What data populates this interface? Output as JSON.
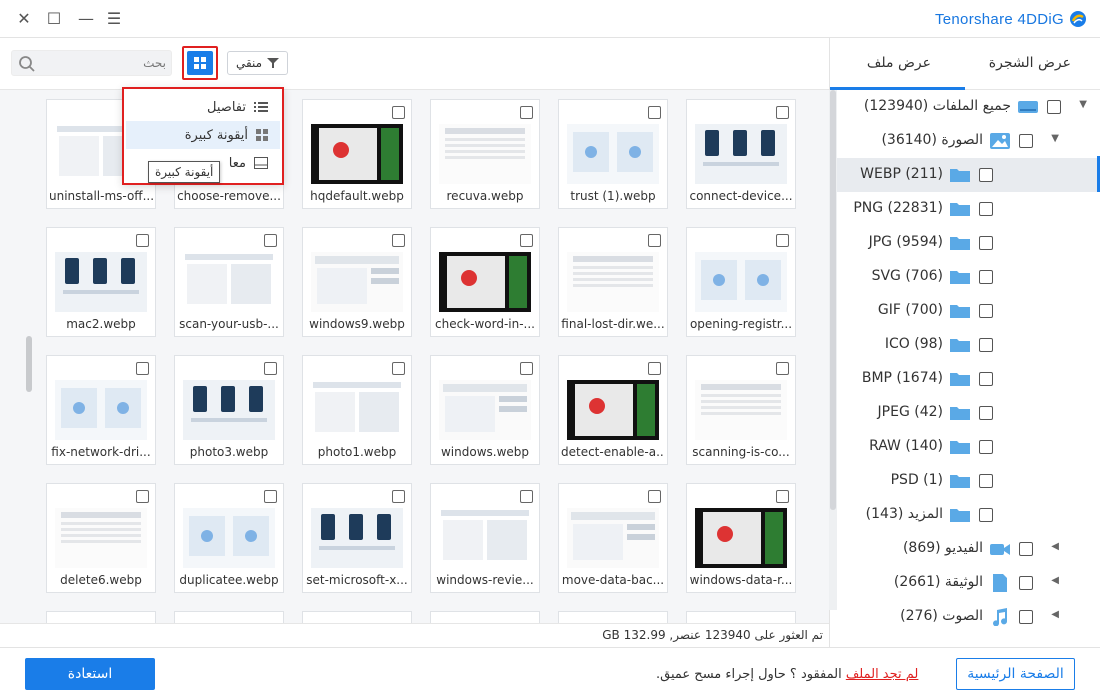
{
  "window": {
    "brand": "Tenorshare 4DDiG",
    "close_glyph": "✕",
    "maximize_glyph": "☐",
    "minimize_glyph": "—",
    "menu_glyph": "☰"
  },
  "toolbar": {
    "search_placeholder": "بحث",
    "filter_label": "منقي",
    "view_button_icon": "grid-icon"
  },
  "view_menu": {
    "items": [
      {
        "label": "تفاصيل",
        "icon": "list-icon"
      },
      {
        "label": "أيقونة كبيرة",
        "icon": "large-icon-grid-icon",
        "selected": true
      },
      {
        "label": "معا",
        "icon": "preview-icon"
      }
    ],
    "tooltip": "أيقونة كبيرة"
  },
  "files": [
    {
      "name": "connect-device..."
    },
    {
      "name": "trust (1).webp"
    },
    {
      "name": "recuva.webp"
    },
    {
      "name": "hqdefault.webp"
    },
    {
      "name": "choose-remove..."
    },
    {
      "name": "uninstall-ms-off..."
    },
    {
      "name": "opening-registr..."
    },
    {
      "name": "final-lost-dir.we..."
    },
    {
      "name": "check-word-in-..."
    },
    {
      "name": "windows9.webp"
    },
    {
      "name": "scan-your-usb-..."
    },
    {
      "name": "mac2.webp"
    },
    {
      "name": "scanning-is-co..."
    },
    {
      "name": "detect-enable-a..."
    },
    {
      "name": "windows.webp"
    },
    {
      "name": "photo1.webp"
    },
    {
      "name": "photo3.webp"
    },
    {
      "name": "fix-network-dri..."
    },
    {
      "name": "windows-data-r..."
    },
    {
      "name": "move-data-bac..."
    },
    {
      "name": "windows-revie..."
    },
    {
      "name": "set-microsoft-x..."
    },
    {
      "name": "duplicatee.webp"
    },
    {
      "name": "delete6.webp"
    }
  ],
  "status": {
    "text": "تم العثور على 123940 عنصر, 132.99 GB"
  },
  "panel": {
    "tabs": [
      {
        "label": "عرض الشجرة",
        "active": true
      },
      {
        "label": "عرض ملف",
        "active": false
      }
    ],
    "tree": [
      {
        "label": "جميع الملفات (123940)",
        "icon": "drive-icon",
        "expand": "▼"
      },
      {
        "label": "الصورة (36140)",
        "icon": "image-icon",
        "expand": "▼"
      },
      {
        "label": "WEBP (211)",
        "icon": "folder-icon",
        "selected": true
      },
      {
        "label": "PNG (22831)",
        "icon": "folder-icon"
      },
      {
        "label": "JPG (9594)",
        "icon": "folder-icon"
      },
      {
        "label": "SVG (706)",
        "icon": "folder-icon"
      },
      {
        "label": "GIF (700)",
        "icon": "folder-icon"
      },
      {
        "label": "ICO (98)",
        "icon": "folder-icon"
      },
      {
        "label": "BMP (1674)",
        "icon": "folder-icon"
      },
      {
        "label": "JPEG (42)",
        "icon": "folder-icon"
      },
      {
        "label": "RAW (140)",
        "icon": "folder-icon"
      },
      {
        "label": "PSD (1)",
        "icon": "folder-icon"
      },
      {
        "label": "المزيد (143)",
        "icon": "folder-icon"
      },
      {
        "label": "الفيديو (869)",
        "icon": "video-icon",
        "expand": "◀"
      },
      {
        "label": "الوثيقة (2661)",
        "icon": "document-icon",
        "expand": "◀"
      },
      {
        "label": "الصوت (276)",
        "icon": "audio-icon",
        "expand": "◀"
      }
    ]
  },
  "footer": {
    "recover_label": "استعادة",
    "hint_link": "لم تجد الملف",
    "hint_text": " المفقود ؟ حاول إجراء مسح عميق.",
    "home_label": "الصفحة الرئيسية"
  },
  "colors": {
    "accent": "#1a7de8",
    "highlight": "#e02020",
    "folder": "#5aa9e6"
  }
}
